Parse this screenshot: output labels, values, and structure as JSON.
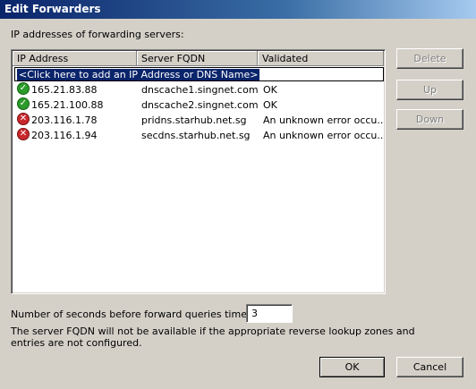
{
  "window": {
    "title": "Edit Forwarders"
  },
  "list_label": "IP addresses of forwarding servers:",
  "columns": [
    "IP Address",
    "Server FQDN",
    "Validated"
  ],
  "add_row_text": "<Click here to add an IP Address or DNS Name>",
  "rows": [
    {
      "status": "ok",
      "status_icon": "check-icon",
      "ip": "165.21.83.88",
      "fqdn": "dnscache1.singnet.com...",
      "validated": "OK"
    },
    {
      "status": "ok",
      "status_icon": "check-icon",
      "ip": "165.21.100.88",
      "fqdn": "dnscache2.singnet.com...",
      "validated": "OK"
    },
    {
      "status": "error",
      "status_icon": "error-icon",
      "ip": "203.116.1.78",
      "fqdn": "pridns.starhub.net.sg",
      "validated": "An unknown error occu..."
    },
    {
      "status": "error",
      "status_icon": "error-icon",
      "ip": "203.116.1.94",
      "fqdn": "secdns.starhub.net.sg",
      "validated": "An unknown error occu..."
    }
  ],
  "buttons": {
    "delete": "Delete",
    "up": "Up",
    "down": "Down",
    "ok": "OK",
    "cancel": "Cancel"
  },
  "timeout": {
    "label": "Number of seconds before forward queries time out:",
    "value": "3"
  },
  "note": "The server FQDN will not be available if the appropriate reverse lookup zones and entries are not configured.",
  "colors": {
    "titlebar_start": "#0a246a",
    "titlebar_end": "#a6caf0",
    "selection": "#0a246a",
    "face": "#d4d0c8"
  }
}
